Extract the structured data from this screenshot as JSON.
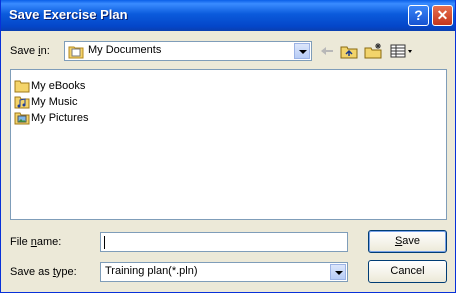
{
  "window": {
    "title": "Save Exercise Plan",
    "help_glyph": "?",
    "close_glyph": "✕"
  },
  "toolbar": {
    "save_in_label": "Save in:",
    "save_in_value": "My Documents",
    "icons": [
      "back-icon",
      "up-folder-icon",
      "new-folder-icon",
      "view-menu-icon"
    ]
  },
  "files": [
    {
      "name": "My eBooks",
      "icon": "folder-icon"
    },
    {
      "name": "My Music",
      "icon": "music-folder-icon"
    },
    {
      "name": "My Pictures",
      "icon": "pictures-folder-icon"
    }
  ],
  "form": {
    "file_name_label": "File name:",
    "file_name_value": "",
    "save_as_type_label": "Save as type:",
    "save_as_type_value": "Training plan(*.pln)"
  },
  "buttons": {
    "save": "Save",
    "cancel": "Cancel"
  },
  "colors": {
    "titlebar": "#0b5bdc",
    "dialog_bg": "#ece9d8",
    "field_border": "#7f9db9"
  }
}
